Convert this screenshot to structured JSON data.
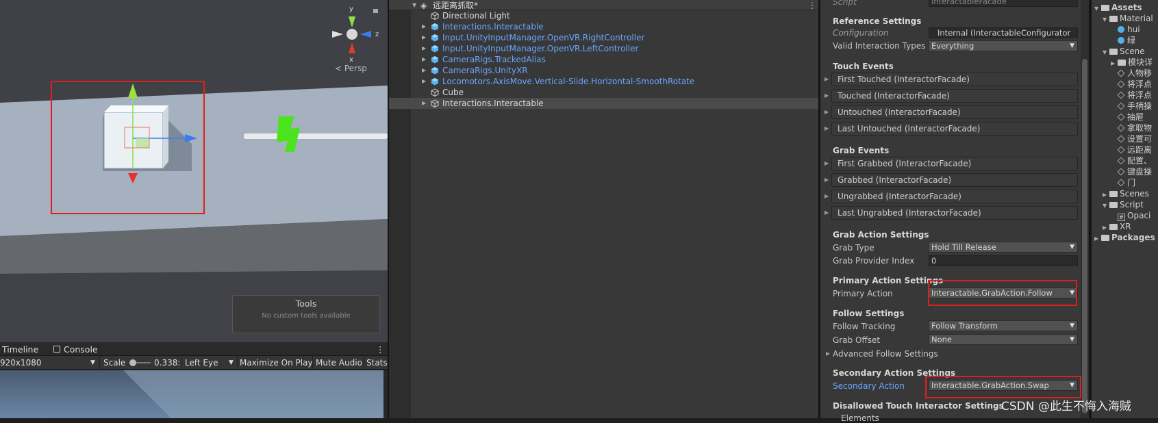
{
  "scene_view": {
    "gizmo_axes": [
      "y",
      "z",
      "x"
    ],
    "persp_label": "< Persp",
    "tools_title": "Tools",
    "tools_subtitle": "No custom tools available"
  },
  "game_bar": {
    "tabs": [
      "Timeline",
      "Console"
    ],
    "resolution": "920x1080",
    "scale_label": "Scale",
    "scale_value": "0.338:",
    "eye": "Left Eye",
    "maximize": "Maximize On Play",
    "mute": "Mute Audio",
    "stats": "Stats"
  },
  "hierarchy": {
    "scene_name": "远距离抓取*",
    "items": [
      {
        "label": "Directional Light",
        "color": "white",
        "arrow": false
      },
      {
        "label": "Interactions.Interactable",
        "color": "blue",
        "arrow": true
      },
      {
        "label": "Input.UnityInputManager.OpenVR.RightController",
        "color": "blue",
        "arrow": true
      },
      {
        "label": "Input.UnityInputManager.OpenVR.LeftController",
        "color": "blue",
        "arrow": true
      },
      {
        "label": "CameraRigs.TrackedAlias",
        "color": "blue",
        "arrow": true
      },
      {
        "label": "CameraRigs.UnityXR",
        "color": "blue",
        "arrow": true
      },
      {
        "label": "Locomotors.AxisMove.Vertical-Slide.Horizontal-SmoothRotate",
        "color": "blue",
        "arrow": true
      },
      {
        "label": "Cube",
        "color": "white",
        "arrow": false
      },
      {
        "label": "Interactions.Interactable",
        "color": "white",
        "arrow": true
      }
    ]
  },
  "inspector": {
    "script_label": "Script",
    "script_value": "InteractableFacade",
    "reference_settings": "Reference Settings",
    "configuration_label": "Configuration",
    "configuration_value": "Internal (InteractableConfigurator",
    "valid_types_label": "Valid Interaction Types",
    "valid_types_value": "Everything",
    "touch_events": "Touch Events",
    "touch_items": [
      "First Touched (InteractorFacade)",
      "Touched (InteractorFacade)",
      "Untouched (InteractorFacade)",
      "Last Untouched (InteractorFacade)"
    ],
    "grab_events": "Grab Events",
    "grab_items": [
      "First Grabbed (InteractorFacade)",
      "Grabbed (InteractorFacade)",
      "Ungrabbed (InteractorFacade)",
      "Last Ungrabbed (InteractorFacade)"
    ],
    "grab_action_settings": "Grab Action Settings",
    "grab_type_label": "Grab Type",
    "grab_type_value": "Hold Till Release",
    "grab_provider_label": "Grab Provider Index",
    "grab_provider_value": "0",
    "primary_action_settings": "Primary Action Settings",
    "primary_action_label": "Primary Action",
    "primary_action_value": "Interactable.GrabAction.Follow",
    "follow_settings": "Follow Settings",
    "follow_tracking_label": "Follow Tracking",
    "follow_tracking_value": "Follow Transform",
    "grab_offset_label": "Grab Offset",
    "grab_offset_value": "None",
    "advanced_follow": "Advanced Follow Settings",
    "secondary_action_settings": "Secondary Action Settings",
    "secondary_action_label": "Secondary Action",
    "secondary_action_value": "Interactable.GrabAction.Swap",
    "disallowed": "Disallowed Touch Interactor Settings",
    "elements": "Elements"
  },
  "project": {
    "items": [
      {
        "label": "Assets",
        "kind": "folder",
        "indent": 0,
        "arrow": "▼",
        "bold": true
      },
      {
        "label": "Material",
        "kind": "folder",
        "indent": 1,
        "arrow": "▼"
      },
      {
        "label": "hui",
        "kind": "mat",
        "indent": 2,
        "arrow": ""
      },
      {
        "label": "绿",
        "kind": "mat",
        "indent": 2,
        "arrow": ""
      },
      {
        "label": "Scene",
        "kind": "folder",
        "indent": 1,
        "arrow": "▼"
      },
      {
        "label": "模块详",
        "kind": "folder",
        "indent": 2,
        "arrow": "▶"
      },
      {
        "label": "人物移",
        "kind": "scene",
        "indent": 2,
        "arrow": ""
      },
      {
        "label": "将浮点",
        "kind": "scene",
        "indent": 2,
        "arrow": ""
      },
      {
        "label": "将浮点",
        "kind": "scene",
        "indent": 2,
        "arrow": ""
      },
      {
        "label": "手柄操",
        "kind": "scene",
        "indent": 2,
        "arrow": ""
      },
      {
        "label": "抽屉",
        "kind": "scene",
        "indent": 2,
        "arrow": ""
      },
      {
        "label": "拿取物",
        "kind": "scene",
        "indent": 2,
        "arrow": ""
      },
      {
        "label": "设置可",
        "kind": "scene",
        "indent": 2,
        "arrow": ""
      },
      {
        "label": "远距离",
        "kind": "scene",
        "indent": 2,
        "arrow": ""
      },
      {
        "label": "配置、",
        "kind": "scene",
        "indent": 2,
        "arrow": ""
      },
      {
        "label": "键盘操",
        "kind": "scene",
        "indent": 2,
        "arrow": ""
      },
      {
        "label": "门",
        "kind": "scene",
        "indent": 2,
        "arrow": ""
      },
      {
        "label": "Scenes",
        "kind": "folder",
        "indent": 1,
        "arrow": "▶"
      },
      {
        "label": "Script",
        "kind": "folder",
        "indent": 1,
        "arrow": "▼"
      },
      {
        "label": "Opaci",
        "kind": "cs",
        "indent": 2,
        "arrow": ""
      },
      {
        "label": "XR",
        "kind": "folder",
        "indent": 1,
        "arrow": "▶"
      },
      {
        "label": "Packages",
        "kind": "folder",
        "indent": 0,
        "arrow": "▶",
        "bold": true
      }
    ]
  },
  "watermark": "CSDN @此生不悔入海贼"
}
